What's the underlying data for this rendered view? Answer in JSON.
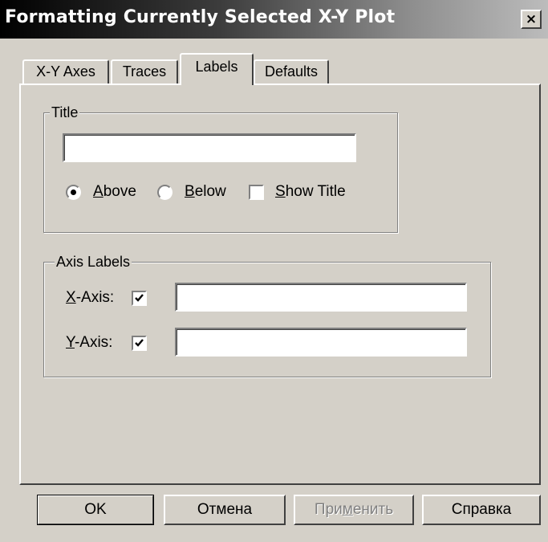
{
  "window": {
    "title": "Formatting Currently Selected X-Y Plot",
    "close_glyph": "×"
  },
  "tabs": [
    {
      "label": "X-Y Axes",
      "active": false
    },
    {
      "label": "Traces",
      "active": false
    },
    {
      "label": "Labels",
      "active": true
    },
    {
      "label": "Defaults",
      "active": false
    }
  ],
  "title_group": {
    "legend": "Title",
    "input_value": "",
    "position_options": [
      {
        "label_hotkey": "A",
        "label_rest": "bove",
        "selected": true
      },
      {
        "label_hotkey": "B",
        "label_rest": "elow",
        "selected": false
      }
    ],
    "show_title": {
      "label_hotkey": "S",
      "label_rest": "how Title",
      "checked": false
    }
  },
  "axis_labels_group": {
    "legend": "Axis Labels",
    "x_axis": {
      "label_hotkey": "X",
      "label_rest": "-Axis:",
      "checked": true,
      "value": ""
    },
    "y_axis": {
      "label_hotkey": "Y",
      "label_rest": "-Axis:",
      "checked": true,
      "value": ""
    }
  },
  "buttons": {
    "ok": "OK",
    "cancel": "Отмена",
    "apply_pre": "При",
    "apply_hotkey": "м",
    "apply_post": "енить",
    "help": "Справка"
  },
  "icons": {
    "close": "close-icon",
    "check": "checkmark-icon"
  }
}
